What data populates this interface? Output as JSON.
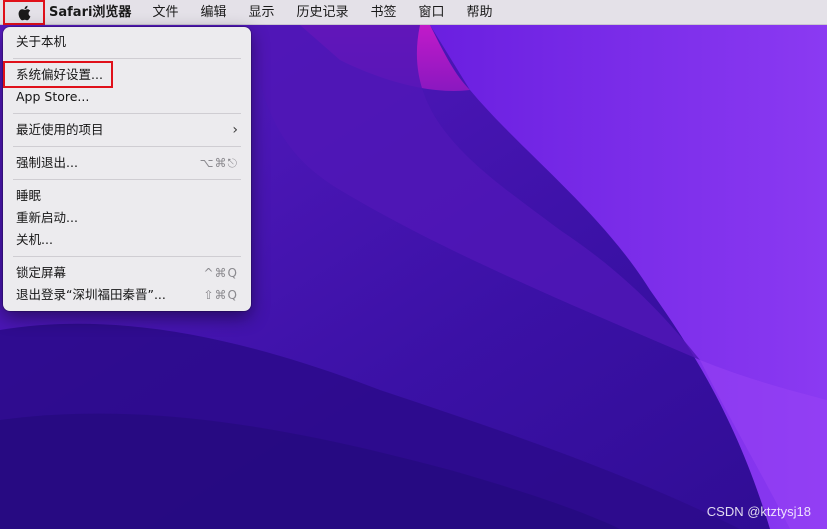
{
  "menubar": {
    "app_name": "Safari浏览器",
    "items": [
      "文件",
      "编辑",
      "显示",
      "历史记录",
      "书签",
      "窗口",
      "帮助"
    ]
  },
  "apple_menu": {
    "about": "关于本机",
    "system_prefs": "系统偏好设置...",
    "app_store": "App Store...",
    "recent_items": "最近使用的项目",
    "force_quit": "强制退出...",
    "force_quit_shortcut": "⌥⌘⎋",
    "sleep": "睡眠",
    "restart": "重新启动...",
    "shutdown": "关机...",
    "lock_screen": "锁定屏幕",
    "lock_screen_shortcut": "^⌘Q",
    "logout": "退出登录“深圳福田秦晋”...",
    "logout_shortcut": "⇧⌘Q"
  },
  "watermark": "CSDN @ktztysj18",
  "colors": {
    "highlight_red": "#e0101a",
    "wallpaper_base": "#3a0fa0",
    "wallpaper_magenta": "#c21ac9"
  }
}
